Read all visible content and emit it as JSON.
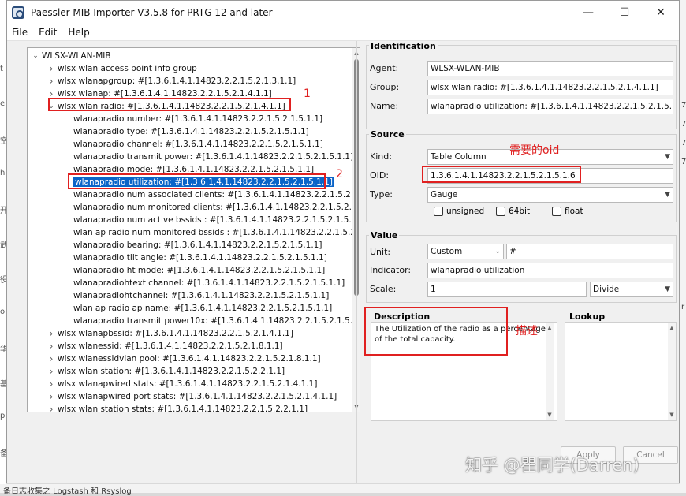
{
  "window": {
    "title": "Paessler MIB Importer V3.5.8 for PRTG 12 and later -",
    "controls": {
      "minimize": "—",
      "maximize": "☐",
      "close": "✕"
    }
  },
  "menu": [
    "File",
    "Edit",
    "Help"
  ],
  "tree": {
    "rows": [
      {
        "label": "WLSX-WLAN-MIB",
        "depth": 0,
        "twisty": "open"
      },
      {
        "label": "wlsx wlan access point info group",
        "depth": 1,
        "twisty": "closed"
      },
      {
        "label": "wlsx wlanapgroup: #[1.3.6.1.4.1.14823.2.2.1.5.2.1.3.1.1]",
        "depth": 1,
        "twisty": "closed"
      },
      {
        "label": "wlsx wlanap: #[1.3.6.1.4.1.14823.2.2.1.5.2.1.4.1.1]",
        "depth": 1,
        "twisty": "closed"
      },
      {
        "label": "wlsx wlan radio: #[1.3.6.1.4.1.14823.2.2.1.5.2.1.4.1.1]",
        "depth": 1,
        "twisty": "open"
      },
      {
        "label": "wlanapradio number: #[1.3.6.1.4.1.14823.2.2.1.5.2.1.5.1.1]",
        "depth": 2
      },
      {
        "label": "wlanapradio type: #[1.3.6.1.4.1.14823.2.2.1.5.2.1.5.1.1]",
        "depth": 2
      },
      {
        "label": "wlanapradio channel: #[1.3.6.1.4.1.14823.2.2.1.5.2.1.5.1.1]",
        "depth": 2
      },
      {
        "label": "wlanapradio transmit power: #[1.3.6.1.4.1.14823.2.2.1.5.2.1.5.1.1]",
        "depth": 2
      },
      {
        "label": "wlanapradio mode: #[1.3.6.1.4.1.14823.2.2.1.5.2.1.5.1.1]",
        "depth": 2
      },
      {
        "label": "wlanapradio utilization: #[1.3.6.1.4.1.14823.2.2.1.5.2.1.5.1.1]",
        "depth": 2,
        "selected": true
      },
      {
        "label": "wlanapradio num associated clients: #[1.3.6.1.4.1.14823.2.2.1.5.2.1",
        "depth": 2
      },
      {
        "label": "wlanapradio num monitored clients: #[1.3.6.1.4.1.14823.2.2.1.5.2.1",
        "depth": 2
      },
      {
        "label": "wlanapradio num active bssids : #[1.3.6.1.4.1.14823.2.2.1.5.2.1.5.1",
        "depth": 2
      },
      {
        "label": "wlan ap radio num monitored bssids : #[1.3.6.1.4.1.14823.2.2.1.5.2.",
        "depth": 2
      },
      {
        "label": "wlanapradio bearing: #[1.3.6.1.4.1.14823.2.2.1.5.2.1.5.1.1]",
        "depth": 2
      },
      {
        "label": "wlanapradio tilt angle: #[1.3.6.1.4.1.14823.2.2.1.5.2.1.5.1.1]",
        "depth": 2
      },
      {
        "label": "wlanapradio ht mode: #[1.3.6.1.4.1.14823.2.2.1.5.2.1.5.1.1]",
        "depth": 2
      },
      {
        "label": "wlanapradiohtext channel: #[1.3.6.1.4.1.14823.2.2.1.5.2.1.5.1.1]",
        "depth": 2
      },
      {
        "label": "wlanapradiohtchannel: #[1.3.6.1.4.1.14823.2.2.1.5.2.1.5.1.1]",
        "depth": 2
      },
      {
        "label": "wlan ap radio ap name: #[1.3.6.1.4.1.14823.2.2.1.5.2.1.5.1.1]",
        "depth": 2
      },
      {
        "label": "wlanapradio transmit power10x: #[1.3.6.1.4.1.14823.2.2.1.5.2.1.5.",
        "depth": 2
      },
      {
        "label": "wlsx wlanapbssid: #[1.3.6.1.4.1.14823.2.2.1.5.2.1.4.1.1]",
        "depth": 1,
        "twisty": "closed"
      },
      {
        "label": "wlsx wlanessid: #[1.3.6.1.4.1.14823.2.2.1.5.2.1.8.1.1]",
        "depth": 1,
        "twisty": "closed"
      },
      {
        "label": "wlsx wlanessidvlan pool: #[1.3.6.1.4.1.14823.2.2.1.5.2.1.8.1.1]",
        "depth": 1,
        "twisty": "closed"
      },
      {
        "label": "wlsx wlan station: #[1.3.6.1.4.1.14823.2.2.1.5.2.2.1.1]",
        "depth": 1,
        "twisty": "closed"
      },
      {
        "label": "wlsx wlanapwired stats: #[1.3.6.1.4.1.14823.2.2.1.5.2.1.4.1.1]",
        "depth": 1,
        "twisty": "closed"
      },
      {
        "label": "wlsx wlanapwired port stats: #[1.3.6.1.4.1.14823.2.2.1.5.2.1.4.1.1]",
        "depth": 1,
        "twisty": "closed"
      },
      {
        "label": "wlsx wlan station stats: #[1.3.6.1.4.1.14823.2.2.1.5.2.2.1.1]",
        "depth": 1,
        "twisty": "closed"
      }
    ]
  },
  "identification": {
    "title": "Identification",
    "agent_label": "Agent:",
    "agent_value": "WLSX-WLAN-MIB",
    "group_label": "Group:",
    "group_value": "wlsx wlan radio: #[1.3.6.1.4.1.14823.2.2.1.5.2.1.4.1.1]",
    "name_label": "Name:",
    "name_value": "wlanapradio utilization: #[1.3.6.1.4.1.14823.2.2.1.5.2.1.5.1."
  },
  "source": {
    "title": "Source",
    "kind_label": "Kind:",
    "kind_value": "Table Column",
    "oid_label": "OID:",
    "oid_value": "1.3.6.1.4.1.14823.2.2.1.5.2.1.5.1.6",
    "type_label": "Type:",
    "type_value": "Gauge",
    "checks": [
      {
        "label": "unsigned",
        "checked": false
      },
      {
        "label": "64bit",
        "checked": false
      },
      {
        "label": "float",
        "checked": false
      }
    ]
  },
  "value": {
    "title": "Value",
    "unit_label": "Unit:",
    "unit_value": "Custom",
    "unit_custom": "#",
    "indicator_label": "Indicator:",
    "indicator_value": "wlanapradio utilization",
    "scale_label": "Scale:",
    "scale_value": "1",
    "scale_op": "Divide"
  },
  "description": {
    "title": "Description",
    "text": "The Utilization of the radio as a percentage of the total capacity."
  },
  "lookup": {
    "title": "Lookup"
  },
  "buttons": {
    "apply": "Apply",
    "cancel": "Cancel"
  },
  "annotations": {
    "marker1": "1",
    "marker2": "2",
    "oid_note": "需要的oid",
    "desc_note": "描述"
  },
  "watermark": "知乎 @瞿同学(Darren)",
  "background": {
    "left_chars": [
      "t",
      "e",
      "空",
      "h",
      "开",
      "武",
      "役",
      "o",
      "华",
      "基",
      "p",
      "备"
    ],
    "right_chars": [
      "7",
      "7",
      "7",
      "7",
      "r"
    ],
    "bottom_text": "备日志收集之 Logstash 和 Rsyslog"
  },
  "colors": {
    "selection": "#0a64c8",
    "annotation": "#e02020"
  }
}
